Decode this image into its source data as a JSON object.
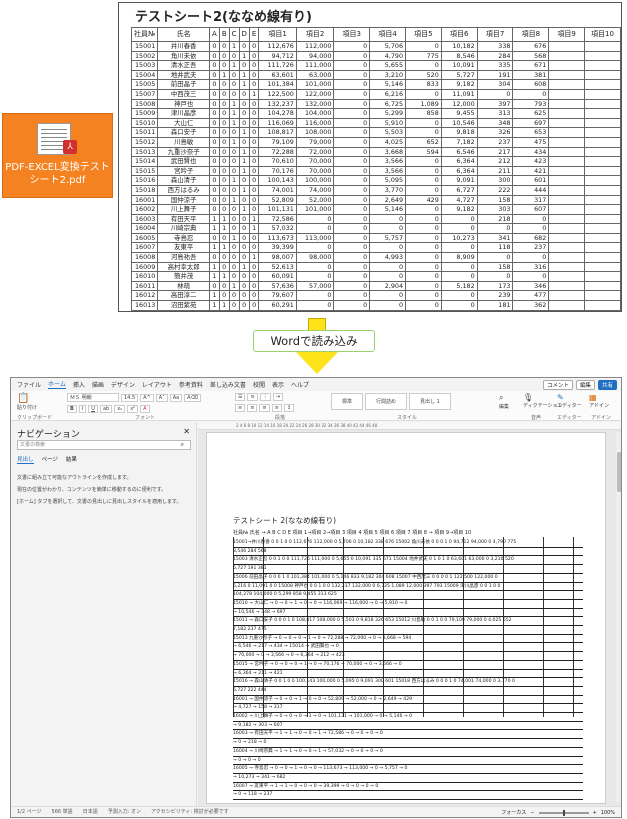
{
  "pdf": {
    "title": "テストシート2(ななめ線有り)",
    "headers": [
      "社員№",
      "氏名",
      "A",
      "B",
      "C",
      "D",
      "E",
      "項目1",
      "項目2",
      "項目3",
      "項目4",
      "項目5",
      "項目6",
      "項目7",
      "項目8",
      "項目9",
      "項目10"
    ],
    "rows": [
      [
        "15001",
        "井川春香",
        "0",
        "0",
        "1",
        "0",
        "0",
        "112,676",
        "112,000",
        "0",
        "5,706",
        "0",
        "10,182",
        "338",
        "676",
        "",
        ""
      ],
      [
        "15002",
        "角川未依",
        "0",
        "0",
        "0",
        "1",
        "0",
        "94,712",
        "94,000",
        "0",
        "4,790",
        "775",
        "8,546",
        "284",
        "568",
        "",
        ""
      ],
      [
        "15003",
        "清水正吾",
        "0",
        "0",
        "1",
        "0",
        "0",
        "111,726",
        "111,000",
        "0",
        "5,655",
        "0",
        "10,091",
        "335",
        "671",
        "",
        ""
      ],
      [
        "15004",
        "地井武夫",
        "0",
        "1",
        "0",
        "1",
        "0",
        "63,601",
        "63,000",
        "0",
        "3,210",
        "520",
        "5,727",
        "191",
        "381",
        "",
        ""
      ],
      [
        "15005",
        "前田晶子",
        "0",
        "0",
        "0",
        "1",
        "0",
        "101,384",
        "101,000",
        "0",
        "5,146",
        "833",
        "9,182",
        "304",
        "608",
        "",
        ""
      ],
      [
        "15007",
        "中西茂三",
        "0",
        "0",
        "0",
        "0",
        "1",
        "122,500",
        "122,000",
        "0",
        "6,216",
        "0",
        "11,091",
        "0",
        "0",
        "",
        ""
      ],
      [
        "15008",
        "神戸也",
        "0",
        "0",
        "1",
        "0",
        "0",
        "132,237",
        "132,000",
        "0",
        "6,725",
        "1,089",
        "12,000",
        "397",
        "793",
        "",
        ""
      ],
      [
        "15009",
        "津川晶彦",
        "0",
        "0",
        "1",
        "0",
        "0",
        "104,278",
        "104,000",
        "0",
        "5,299",
        "858",
        "9,455",
        "313",
        "625",
        "",
        ""
      ],
      [
        "15010",
        "大山仁",
        "0",
        "0",
        "1",
        "0",
        "0",
        "116,069",
        "116,000",
        "0",
        "5,910",
        "0",
        "10,546",
        "348",
        "697",
        "",
        ""
      ],
      [
        "15011",
        "森口安子",
        "0",
        "0",
        "0",
        "1",
        "0",
        "108,817",
        "108,000",
        "0",
        "5,503",
        "0",
        "9,818",
        "326",
        "653",
        "",
        ""
      ],
      [
        "15012",
        "川島敏",
        "0",
        "0",
        "1",
        "0",
        "0",
        "79,109",
        "79,000",
        "0",
        "4,025",
        "652",
        "7,182",
        "237",
        "475",
        "",
        ""
      ],
      [
        "15013",
        "九重沙奈子",
        "0",
        "0",
        "0",
        "1",
        "0",
        "72,288",
        "72,000",
        "0",
        "3,668",
        "594",
        "6,546",
        "217",
        "434",
        "",
        ""
      ],
      [
        "15014",
        "武田賢也",
        "0",
        "0",
        "0",
        "1",
        "0",
        "70,610",
        "70,000",
        "0",
        "3,566",
        "0",
        "6,364",
        "212",
        "423",
        "",
        ""
      ],
      [
        "15015",
        "宮吟子",
        "0",
        "0",
        "0",
        "1",
        "0",
        "70,176",
        "70,000",
        "0",
        "3,566",
        "0",
        "6,364",
        "211",
        "421",
        "",
        ""
      ],
      [
        "15016",
        "森山清子",
        "0",
        "0",
        "1",
        "0",
        "0",
        "100,143",
        "100,000",
        "0",
        "5,095",
        "0",
        "9,091",
        "300",
        "601",
        "",
        ""
      ],
      [
        "15018",
        "西方はるみ",
        "0",
        "0",
        "0",
        "1",
        "0",
        "74,001",
        "74,000",
        "0",
        "3,770",
        "0",
        "6,727",
        "222",
        "444",
        "",
        ""
      ],
      [
        "16001",
        "国仲涼子",
        "0",
        "0",
        "1",
        "0",
        "0",
        "52,809",
        "52,000",
        "0",
        "2,649",
        "429",
        "4,727",
        "158",
        "317",
        "",
        ""
      ],
      [
        "16002",
        "川上舞子",
        "0",
        "0",
        "0",
        "1",
        "0",
        "101,131",
        "101,000",
        "0",
        "5,146",
        "0",
        "9,182",
        "303",
        "607",
        "",
        ""
      ],
      [
        "16003",
        "有田天平",
        "1",
        "1",
        "0",
        "0",
        "1",
        "72,586",
        "0",
        "0",
        "0",
        "0",
        "0",
        "218",
        "0",
        "",
        ""
      ],
      [
        "16004",
        "川崎宗典",
        "1",
        "1",
        "0",
        "0",
        "1",
        "57,032",
        "0",
        "0",
        "0",
        "0",
        "0",
        "0",
        "0",
        "",
        ""
      ],
      [
        "16005",
        "寺島忍",
        "0",
        "0",
        "1",
        "0",
        "0",
        "113,673",
        "113,000",
        "0",
        "5,757",
        "0",
        "10,273",
        "341",
        "682",
        "",
        ""
      ],
      [
        "16007",
        "友東平",
        "1",
        "1",
        "0",
        "0",
        "0",
        "39,399",
        "0",
        "0",
        "0",
        "0",
        "0",
        "118",
        "237",
        "",
        ""
      ],
      [
        "16008",
        "河島祐吾",
        "0",
        "0",
        "0",
        "0",
        "1",
        "98,007",
        "98,000",
        "0",
        "4,993",
        "0",
        "8,909",
        "0",
        "0",
        "",
        ""
      ],
      [
        "16009",
        "高村幸太郎",
        "1",
        "0",
        "0",
        "1",
        "0",
        "52,613",
        "0",
        "0",
        "0",
        "0",
        "0",
        "158",
        "316",
        "",
        ""
      ],
      [
        "16010",
        "簡井茂",
        "1",
        "1",
        "0",
        "0",
        "0",
        "60,091",
        "0",
        "0",
        "0",
        "0",
        "0",
        "0",
        "0",
        "",
        ""
      ],
      [
        "16011",
        "林萌",
        "0",
        "0",
        "1",
        "0",
        "0",
        "57,636",
        "57,000",
        "0",
        "2,904",
        "0",
        "5,182",
        "173",
        "346",
        "",
        ""
      ],
      [
        "16012",
        "高田淳二",
        "1",
        "0",
        "0",
        "0",
        "0",
        "79,607",
        "0",
        "0",
        "0",
        "0",
        "0",
        "239",
        "477",
        "",
        ""
      ],
      [
        "16013",
        "沼田紫苑",
        "1",
        "1",
        "0",
        "0",
        "0",
        "60,291",
        "0",
        "0",
        "0",
        "0",
        "0",
        "181",
        "362",
        "",
        ""
      ]
    ],
    "total": [
      "",
      "合計",
      "7",
      "3",
      "14",
      "9",
      "3",
      "2,379,282",
      "1,949,000",
      "0",
      "99,299",
      "5,750",
      "177,185",
      "5,906",
      "11,814",
      "",
      ""
    ]
  },
  "file_icon": {
    "label": "PDF-EXCEL変換テストシート2.pdf"
  },
  "arrow_caption": "Wordで読み込み",
  "word": {
    "menu": [
      "ファイル",
      "ホーム",
      "挿入",
      "描画",
      "デザイン",
      "レイアウト",
      "参考資料",
      "差し込み文書",
      "校閲",
      "表示",
      "ヘルプ"
    ],
    "active_menu": "ホーム",
    "comment_btn": "コメント",
    "edit_btn": "編集",
    "share_btn": "共有",
    "ribbon": {
      "paste": "貼り付け",
      "clipboard": "クリップボード",
      "font_name": "ＭＳ 明朝",
      "font_size": "14.5",
      "font_group": "フォント",
      "paragraph_group": "段落",
      "style1": "標準",
      "style2": "行間詰め",
      "style3": "見出し 1",
      "style_group": "スタイル",
      "edit": "編集",
      "dictation": "ディクテーション",
      "editor": "エディター",
      "addin": "アドイン",
      "voice_group": "音声",
      "editor_group": "エディター",
      "addin_group": "アドイン"
    },
    "nav": {
      "title": "ナビゲーション",
      "search_placeholder": "文書の検索",
      "tabs": [
        "見出し",
        "ページ",
        "結果"
      ],
      "text1": "文書に組み立て可能なアウトラインを作成します。",
      "text2": "現在の位置がわかり、コンテンツを簡単に移動するのに便利です。",
      "text3": "[ホーム] タブを選択して、文書の見出しに見出しスタイルを適用します。"
    },
    "ruler": "2  4  6  8  10  12  14  16  18  20  22  24  26  28  30  32  34  36  38  40  42  44  46  48",
    "doc_title": "テストシート 2(ななめ線有り)",
    "doc_header": "社員№  氏名  →  A B C D E 項目 1→項目 2→項目 3 項目 4 項目 5 項目 6 項目 7",
    "doc_sub": "項目 8 → 項目 9→項目 10",
    "doc_lines": [
      "15001→井川春香 0 0 1 0 0 112,676 112,000 0 5,706 0 10,182 338 676 15002 角川未依 0 0 0 1 0 94,712 94,000 0 4,790 775",
      "8,546 284 568",
      "15003 清水正吾 0 0 1 0 0 111,726 111,000 0 5,655 0 10,091 335 671 15004 地井武夫 0 1 0 1 0 63,601 63,000 0 3,210 520",
      "5,727 191 381",
      "15006 前田晶子 0 0 0 1 0 101,384 101,000 0 5,146 833 9,182 304 608 15007 中西茂三 0 0 0 0 1 122,500 122,000 0",
      "6,216 0 11,091 0 0 15008 神戸也 0 0 1 0 0 132,237 132,000 0 6,725 1,089 12,000 397 793 15009 津川晶彦 0 0 1 0 0",
      "104,278 104,000 0 5,299 858 9,455 313 625",
      "15010 → 大山仁 → 0 → 0 → 1 → 0 → 0 → 116,069 → 116,000 → 0 → 5,910 → 0",
      "→ 10,546 → 348 → 697",
      "15011 → 森口安子 0 0 0 1 0 108,817 108,000 0 5,503 0 9,818 326 653 15012 川島敏 0 0 1 0 0 79,109 79,000 0 4,025 652",
      "7,182 237 475",
      "15013 九重沙奈子 → 0 → 0 → 0 → 1 → 0 → 72,288 → 72,000 → 0 → 3,668 → 594",
      "→ 6,546 → 217 → 434 → 15014 → 武田賢也 → 0",
      "→ 70,000 → 0 → 3,566 → 0 → 6,364 → 212 → 423",
      "15015 → 宮吟子 → 0 → 0 → 0 → 1 → 0 → 70,176 → 70,000 → 0 → 3,566 → 0",
      "→ 6,364 → 211 → 421",
      "15016 → 森山清子 0 0 1 0 0 100,143 100,000 0 5,095 0 9,091 300 601 15018 西方はるみ 0 0 0 1 0 74,001 74,000 0 3,770 0",
      "6,727 222 444",
      "16001 → 国仲涼子 → 0 → 0 → 1 → 0 → 0 → 52,809 → 52,000 → 0 → 2,649 → 429",
      "→ 4,727 → 158 → 317",
      "16002 → 川上舞子 → 0 → 0 → 0 → 1 → 0 → 101,131 → 101,000 → 0 → 5,146 → 0",
      "→ 9,182 → 303 → 607",
      "16003 → 有田天平 → 1 → 1 → 0 → 0 → 1 → 72,586 → 0 → 0 → 0 → 0",
      "→ 0 → 218 → 0",
      "16004 → 川崎宗典 → 1 → 1 → 0 → 0 → 1 → 57,032 → 0 → 0 → 0 → 0",
      "→ 0 → 0 → 0",
      "16005 → 寺島忍 → 0 → 0 → 1 → 0 → 0 → 113,673 → 113,000 → 0 → 5,757 → 0",
      "→ 10,273 → 341 → 682",
      "16007 → 友東平 → 1 → 1 → 0 → 0 → 0 → 39,399 → 0 → 0 → 0 → 0",
      "→ 0 → 118 → 237"
    ],
    "status": {
      "page": "1/2 ページ",
      "words": "566 単語",
      "lang": "日本語",
      "input": "予測入力: オン",
      "focus": "フォーカス",
      "accessibility": "アクセシビリティ: 検討が必要です",
      "zoom": "100%"
    }
  }
}
